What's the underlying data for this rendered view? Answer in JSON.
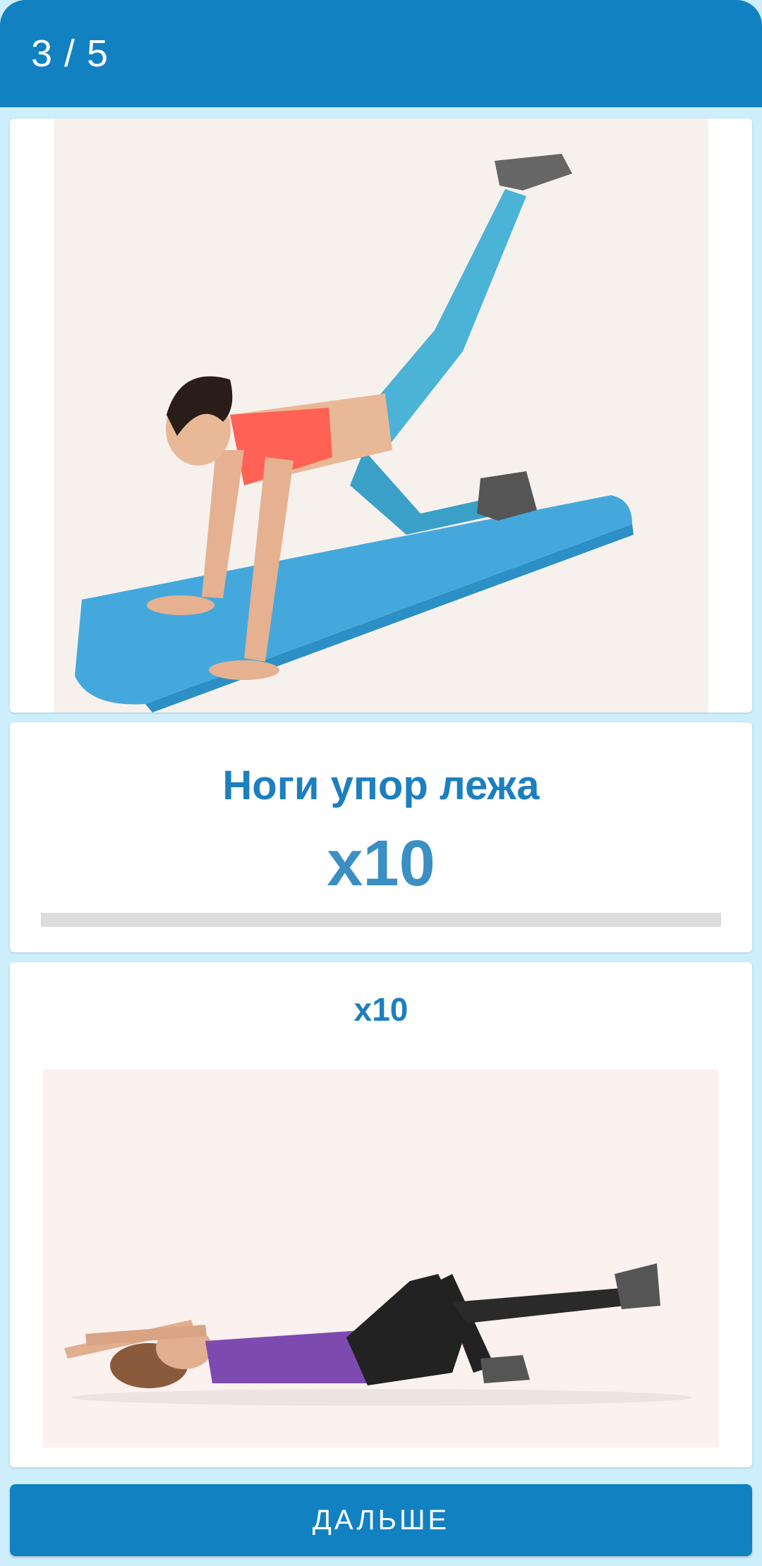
{
  "header": {
    "counter": "3 / 5"
  },
  "current_exercise": {
    "name": "Ноги упор лежа",
    "reps": "x10",
    "progress": 0
  },
  "next_exercise": {
    "reps": "x10"
  },
  "footer": {
    "next_button_label": "ДАЛЬШЕ"
  },
  "colors": {
    "primary": "#1181c2",
    "background": "#cdeefb",
    "accent_text": "#1c7fbf"
  }
}
